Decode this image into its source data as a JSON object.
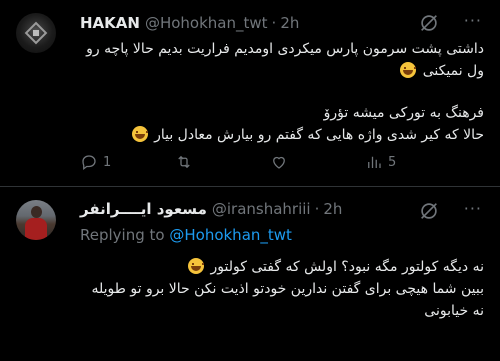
{
  "tweets": [
    {
      "display_name": "HAKAN",
      "handle": "@Hohokhan_twt",
      "separator": "·",
      "time": "2h",
      "lines": [
        "داشتی پشت سرمون پارس میکردی اومدیم فراریت بدیم حالا پاچه رو",
        "ول نمیکنی",
        "",
        "فرهنگ به تورکی میشه تؤرۆ",
        "حالا که کیر شدی واژه هایی که گفتم رو بیارش معادل بیار"
      ],
      "emoji_lines": [
        1,
        4
      ],
      "actions": {
        "reply": "1",
        "retweet": "",
        "like": "",
        "views": "5"
      }
    },
    {
      "display_name": "مسعود ایــــرانفر",
      "handle": "@iranshahriii",
      "separator": "·",
      "time": "2h",
      "replying_prefix": "Replying to",
      "replying_to": "@Hohokhan_twt",
      "lines": [
        "نه دیگه کولتور مگه نبود؟ اولش که گفتی کولتور",
        "ببین شما هیچی برای گفتن ندارین خودتو اذیت نکن حالا برو تو طویله",
        "نه خیابونی"
      ],
      "emoji_lines": [
        0
      ]
    }
  ],
  "icons": {
    "grok": "grok-slash-icon",
    "more": "more-horizontal-icon",
    "reply": "reply-icon",
    "retweet": "retweet-icon",
    "like": "heart-icon",
    "views": "views-icon"
  },
  "colors": {
    "background": "#000000",
    "text": "#e7e9ea",
    "muted": "#71767b",
    "link": "#1d9bf0",
    "divider": "#2f3336"
  }
}
